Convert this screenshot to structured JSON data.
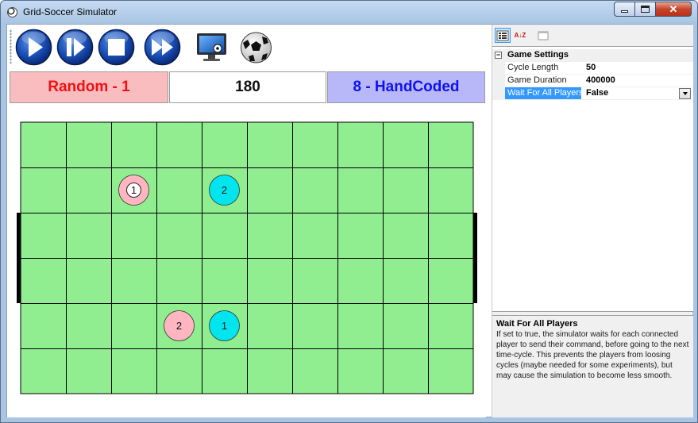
{
  "window": {
    "title": "Grid-Soccer Simulator",
    "close_glyph": "✕"
  },
  "toolbar": {
    "buttons": [
      {
        "name": "play-icon"
      },
      {
        "name": "step-icon"
      },
      {
        "name": "stop-icon"
      },
      {
        "name": "fast-forward-icon"
      },
      {
        "name": "monitor-icon"
      },
      {
        "name": "soccer-ball-icon"
      }
    ]
  },
  "scoreboard": {
    "left_team": "Random - 1",
    "cycle": "180",
    "right_team": "8 - HandCoded"
  },
  "field": {
    "rows": 6,
    "cols": 10,
    "colors": {
      "grass": "#90ee90",
      "lines": "#000000",
      "goal": "#000000",
      "left_team": "#ffb6c1",
      "right_team": "#00e5ee"
    },
    "players": [
      {
        "team": "left",
        "number": "1",
        "row": 1,
        "col": 2,
        "has_ball": true
      },
      {
        "team": "right",
        "number": "2",
        "row": 1,
        "col": 4,
        "has_ball": false
      },
      {
        "team": "left",
        "number": "2",
        "row": 4,
        "col": 3,
        "has_ball": false
      },
      {
        "team": "right",
        "number": "1",
        "row": 4,
        "col": 4,
        "has_ball": false
      }
    ]
  },
  "property_grid": {
    "sort_alpha_glyph": "A↓Z",
    "category": "Game Settings",
    "expander": "−",
    "properties": [
      {
        "name": "Cycle Length",
        "value": "50",
        "selected": false
      },
      {
        "name": "Game Duration",
        "value": "400000",
        "selected": false
      },
      {
        "name": "Wait For All Players",
        "value": "False",
        "selected": true
      }
    ],
    "help_title": "Wait For All Players",
    "help_text": "If set to true, the simulator waits for each connected player to send their command, before going to the next time-cycle. This prevents the players from loosing cycles (maybe needed for some experiments), but may cause the simulation to become less smooth."
  }
}
